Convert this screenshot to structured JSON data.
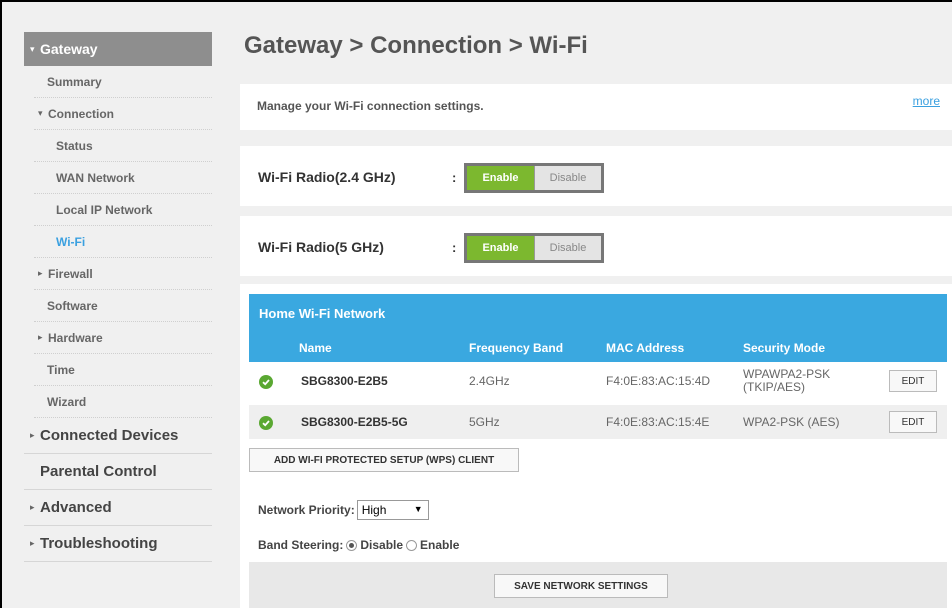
{
  "page": {
    "title": "Gateway > Connection > Wi-Fi"
  },
  "sidebar": {
    "header": "Gateway",
    "items": [
      {
        "label": "Summary"
      },
      {
        "label": "Connection"
      },
      {
        "label": "Status"
      },
      {
        "label": "WAN Network"
      },
      {
        "label": "Local IP Network"
      },
      {
        "label": "Wi-Fi"
      },
      {
        "label": "Firewall"
      },
      {
        "label": "Software"
      },
      {
        "label": "Hardware"
      },
      {
        "label": "Time"
      },
      {
        "label": "Wizard"
      }
    ],
    "sections": [
      {
        "label": "Connected Devices"
      },
      {
        "label": "Parental Control"
      },
      {
        "label": "Advanced"
      },
      {
        "label": "Troubleshooting"
      }
    ]
  },
  "intro": {
    "text": "Manage your Wi-Fi connection settings.",
    "more": "more"
  },
  "radio24": {
    "label": "Wi-Fi Radio(2.4 GHz)",
    "colon": ":",
    "enable": "Enable",
    "disable": "Disable"
  },
  "radio5": {
    "label": "Wi-Fi Radio(5 GHz)",
    "colon": ":",
    "enable": "Enable",
    "disable": "Disable"
  },
  "network": {
    "title": "Home Wi-Fi Network",
    "columns": {
      "name": "Name",
      "band": "Frequency Band",
      "mac": "MAC Address",
      "security": "Security Mode"
    },
    "rows": [
      {
        "name": "SBG8300-E2B5",
        "band": "2.4GHz",
        "mac": "F4:0E:83:AC:15:4D",
        "security": "WPAWPA2-PSK (TKIP/AES)",
        "edit": "EDIT"
      },
      {
        "name": "SBG8300-E2B5-5G",
        "band": "5GHz",
        "mac": "F4:0E:83:AC:15:4E",
        "security": "WPA2-PSK (AES)",
        "edit": "EDIT"
      }
    ],
    "wps_button": "ADD WI-FI PROTECTED SETUP (WPS) CLIENT",
    "priority_label": "Network Priority:",
    "priority_value": "High",
    "steering_label": "Band Steering:",
    "steering_disable": "Disable",
    "steering_enable": "Enable",
    "save_button": "SAVE NETWORK SETTINGS"
  }
}
